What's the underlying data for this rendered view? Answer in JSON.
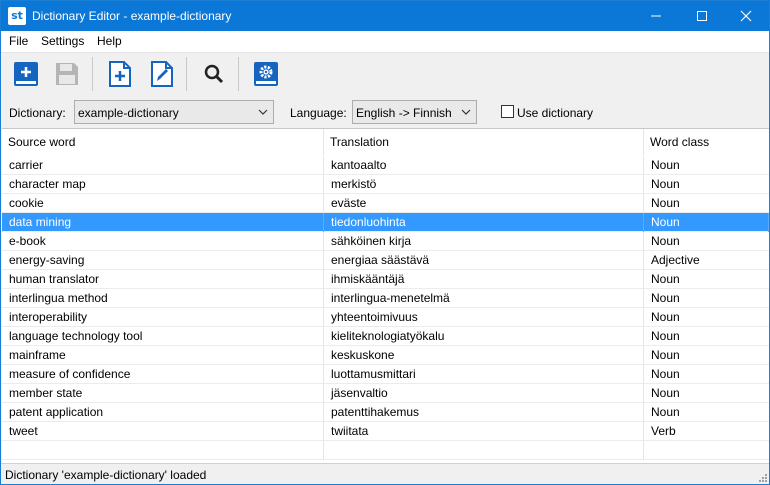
{
  "window": {
    "title": "Dictionary Editor - example-dictionary",
    "app_icon_text": "st"
  },
  "menu": [
    "File",
    "Settings",
    "Help"
  ],
  "toolbar": {
    "icons": [
      "new-dictionary-icon",
      "save-icon",
      "add-entry-icon",
      "edit-entry-icon",
      "search-icon",
      "settings-icon"
    ],
    "accent_color": "#1565c0"
  },
  "options": {
    "dictionary_label": "Dictionary:",
    "dictionary_value": "example-dictionary",
    "language_label": "Language:",
    "language_value": "English -> Finnish",
    "use_dictionary_label": "Use dictionary",
    "use_dictionary_checked": false
  },
  "table": {
    "headers": [
      "Source word",
      "Translation",
      "Word class"
    ],
    "rows": [
      [
        "carrier",
        "kantoaalto",
        "Noun"
      ],
      [
        "character map",
        "merkistö",
        "Noun"
      ],
      [
        "cookie",
        "eväste",
        "Noun"
      ],
      [
        "data mining",
        "tiedonluohinta",
        "Noun"
      ],
      [
        "e-book",
        "sähköinen kirja",
        "Noun"
      ],
      [
        "energy-saving",
        "energiaa säästävä",
        "Adjective"
      ],
      [
        "human translator",
        "ihmiskääntäjä",
        "Noun"
      ],
      [
        "interlingua method",
        "interlingua-menetelmä",
        "Noun"
      ],
      [
        "interoperability",
        "yhteentoimivuus",
        "Noun"
      ],
      [
        "language technology tool",
        "kieliteknologiatyökalu",
        "Noun"
      ],
      [
        "mainframe",
        "keskuskone",
        "Noun"
      ],
      [
        "measure of confidence",
        "luottamusmittari",
        "Noun"
      ],
      [
        "member state",
        "jäsenvaltio",
        "Noun"
      ],
      [
        "patent application",
        "patenttihakemus",
        "Noun"
      ],
      [
        "tweet",
        "twiitata",
        "Verb"
      ]
    ],
    "selected_row": 3,
    "selection_color": "#3399ff"
  },
  "status": {
    "text": "Dictionary 'example-dictionary' loaded"
  }
}
